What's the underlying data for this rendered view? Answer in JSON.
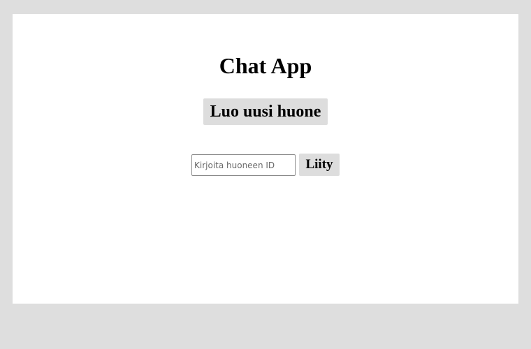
{
  "app": {
    "title": "Chat App"
  },
  "actions": {
    "create_room_label": "Luo uusi huone",
    "join_label": "Liity"
  },
  "join_form": {
    "room_id_value": "",
    "room_id_placeholder": "Kirjoita huoneen ID"
  },
  "colors": {
    "background": "#dedede",
    "panel": "#ffffff",
    "button": "#dddddd",
    "text": "#000000"
  }
}
